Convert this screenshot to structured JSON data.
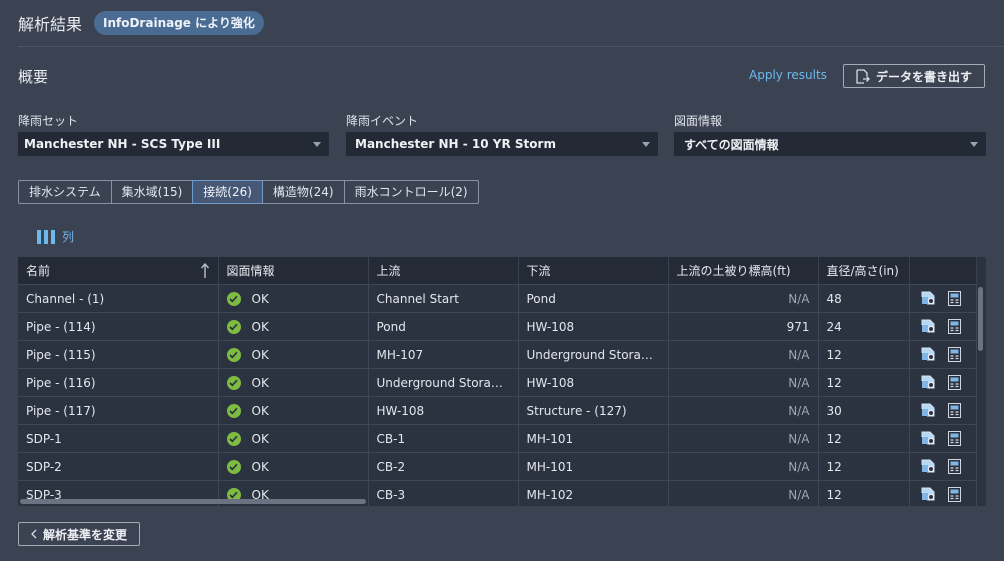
{
  "header": {
    "title": "解析結果",
    "badge": "InfoDrainage により強化"
  },
  "overview": {
    "title": "概要",
    "apply_results": "Apply results",
    "export_label": "データを書き出す"
  },
  "filters": [
    {
      "label": "降雨セット",
      "value": "Manchester NH - SCS Type III"
    },
    {
      "label": "降雨イベント",
      "value": "Manchester NH - 10 YR Storm"
    },
    {
      "label": "図面情報",
      "value": "すべての図面情報"
    }
  ],
  "tabs": [
    {
      "label": "排水システム",
      "active": false
    },
    {
      "label": "集水域(15)",
      "active": false
    },
    {
      "label": "接続(26)",
      "active": true
    },
    {
      "label": "構造物(24)",
      "active": false
    },
    {
      "label": "雨水コントロール(2)",
      "active": false
    }
  ],
  "columns_button": "列",
  "table": {
    "headers": [
      "名前",
      "図面情報",
      "上流",
      "下流",
      "上流の土被り標高(ft)",
      "直径/高さ(in)",
      ""
    ],
    "rows": [
      {
        "name": "Channel - (1)",
        "status": "OK",
        "upstream": "Channel Start",
        "downstream": "Pond",
        "cover": "N/A",
        "diameter": "48"
      },
      {
        "name": "Pipe - (114)",
        "status": "OK",
        "upstream": "Pond",
        "downstream": "HW-108",
        "cover": "971",
        "diameter": "24"
      },
      {
        "name": "Pipe - (115)",
        "status": "OK",
        "upstream": "MH-107",
        "downstream": "Underground Storage ...",
        "cover": "N/A",
        "diameter": "12"
      },
      {
        "name": "Pipe - (116)",
        "status": "OK",
        "upstream": "Underground Storage ...",
        "downstream": "HW-108",
        "cover": "N/A",
        "diameter": "12"
      },
      {
        "name": "Pipe - (117)",
        "status": "OK",
        "upstream": "HW-108",
        "downstream": "Structure - (127)",
        "cover": "N/A",
        "diameter": "30"
      },
      {
        "name": "SDP-1",
        "status": "OK",
        "upstream": "CB-1",
        "downstream": "MH-101",
        "cover": "N/A",
        "diameter": "12"
      },
      {
        "name": "SDP-2",
        "status": "OK",
        "upstream": "CB-2",
        "downstream": "MH-101",
        "cover": "N/A",
        "diameter": "12"
      },
      {
        "name": "SDP-3",
        "status": "OK",
        "upstream": "CB-3",
        "downstream": "MH-102",
        "cover": "N/A",
        "diameter": "12"
      }
    ]
  },
  "footer": {
    "change_criteria": "解析基準を変更"
  },
  "colors": {
    "accent": "#6fb8ec",
    "ok": "#7dbb41",
    "background": "#3b4252"
  }
}
